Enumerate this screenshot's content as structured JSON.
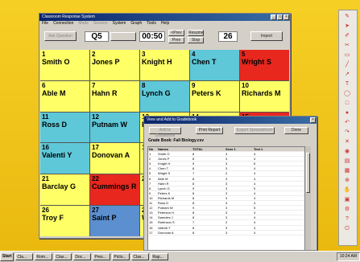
{
  "main_window": {
    "title": "Classroom Response System",
    "menu": [
      "File",
      "Connection",
      "Mode",
      "Session",
      "System",
      "Graph",
      "Tools",
      "Help"
    ],
    "question_button": "Ask Question",
    "question_number": "Q5",
    "timer": "00:50",
    "small_buttons": [
      "<Prev",
      "Prev",
      "Resume",
      "Stop"
    ],
    "count": "26",
    "right_button": "Import"
  },
  "students": [
    {
      "num": "1",
      "name": "Smith O",
      "color": "yellow"
    },
    {
      "num": "2",
      "name": "Jones P",
      "color": "yellow"
    },
    {
      "num": "3",
      "name": "Knight H",
      "color": "yellow"
    },
    {
      "num": "4",
      "name": "Chen T",
      "color": "cyan"
    },
    {
      "num": "5",
      "name": "Wright S",
      "color": "red"
    },
    {
      "num": "6",
      "name": "Able M",
      "color": "yellow"
    },
    {
      "num": "7",
      "name": "Hahn R",
      "color": "yellow"
    },
    {
      "num": "8",
      "name": "Lynch G",
      "color": "cyan"
    },
    {
      "num": "9",
      "name": "Peters K",
      "color": "yellow"
    },
    {
      "num": "10",
      "name": "Richards M",
      "color": "yellow"
    },
    {
      "num": "11",
      "name": "Ross D",
      "color": "cyan"
    },
    {
      "num": "12",
      "name": "Putnam W",
      "color": "cyan"
    },
    {
      "num": "13",
      "name": "Peterson H",
      "color": "yellow"
    },
    {
      "num": "14",
      "name": "Samules J",
      "color": "yellow"
    },
    {
      "num": "15",
      "name": "Robinson S",
      "color": "red"
    },
    {
      "num": "16",
      "name": "Valenti Y",
      "color": "cyan"
    },
    {
      "num": "17",
      "name": "Donovan A",
      "color": "yellow"
    },
    {
      "num": "18",
      "name": "",
      "color": "yellow"
    },
    {
      "num": "19",
      "name": "",
      "color": "yellow"
    },
    {
      "num": "20",
      "name": "",
      "color": "yellow"
    },
    {
      "num": "21",
      "name": "Barclay G",
      "color": "yellow"
    },
    {
      "num": "22",
      "name": "Cummings R",
      "color": "red"
    },
    {
      "num": "23",
      "name": "",
      "color": "yellow"
    },
    {
      "num": "24",
      "name": "",
      "color": "yellow"
    },
    {
      "num": "25",
      "name": "",
      "color": "yellow"
    },
    {
      "num": "26",
      "name": "Troy F",
      "color": "yellow"
    },
    {
      "num": "27",
      "name": "Saint P",
      "color": "blue"
    },
    {
      "num": "28",
      "name": "W",
      "color": "yellow"
    },
    {
      "num": "29",
      "name": "",
      "color": "yellow"
    },
    {
      "num": "30",
      "name": "",
      "color": "yellow"
    }
  ],
  "gradebook": {
    "title": "View and Add to Gradebook",
    "buttons": [
      "Add to Gradebook",
      "Print Report",
      "Export Spreadsheet",
      "Done"
    ],
    "header": "Grade Book: Fall Biology.csv",
    "columns": [
      "No",
      "Names",
      "TOTAL",
      "Sess 1",
      "Test 1"
    ],
    "rows": [
      [
        "1",
        "Smith O",
        "8",
        "3",
        "4"
      ],
      [
        "2",
        "Jones P",
        "8",
        "3",
        "4"
      ],
      [
        "3",
        "Knight H",
        "9",
        "3",
        "5"
      ],
      [
        "4",
        "Chen T",
        "8",
        "3",
        "4"
      ],
      [
        "5",
        "Wright S",
        "7",
        "2",
        "4"
      ],
      [
        "6",
        "Able M",
        "8",
        "3",
        "4"
      ],
      [
        "7",
        "Hahn R",
        "8",
        "3",
        "4"
      ],
      [
        "8",
        "Lynch G",
        "9",
        "3",
        "5"
      ],
      [
        "9",
        "Peters K",
        "8",
        "3",
        "4"
      ],
      [
        "10",
        "Richards M",
        "8",
        "3",
        "4"
      ],
      [
        "11",
        "Ross D",
        "8",
        "3",
        "4"
      ],
      [
        "12",
        "Putnam W",
        "9",
        "3",
        "5"
      ],
      [
        "13",
        "Peterson H",
        "8",
        "3",
        "4"
      ],
      [
        "14",
        "Samules J",
        "8",
        "3",
        "4"
      ],
      [
        "15",
        "Robinson S",
        "7",
        "2",
        "4"
      ],
      [
        "16",
        "Valenti Y",
        "8",
        "3",
        "4"
      ],
      [
        "17",
        "Donovan A",
        "8",
        "3",
        "4"
      ]
    ]
  },
  "taskbar": {
    "start": "Start",
    "tasks": [
      "Cla...",
      "Rom...",
      "Clas...",
      "Doc...",
      "Pres...",
      "Picto...",
      "Clas...",
      "Rap..."
    ],
    "clock": "10:24 AM"
  }
}
